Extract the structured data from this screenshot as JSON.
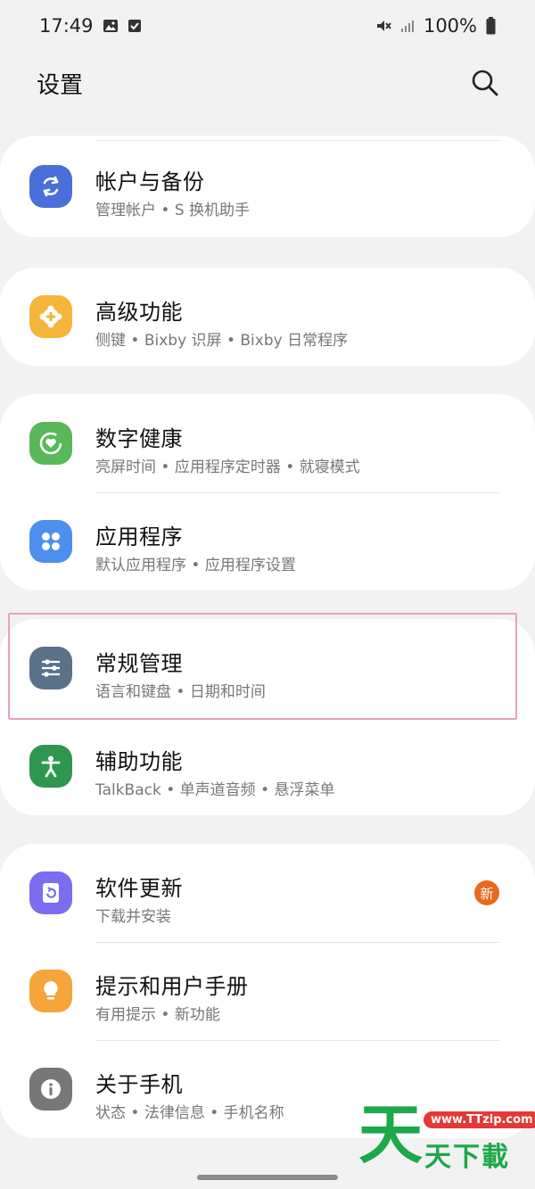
{
  "status_bar": {
    "time": "17:49",
    "icons_left": [
      "image-icon",
      "checkbox-icon"
    ],
    "icons_right": [
      "mute-icon",
      "signal-icon",
      "battery-icon"
    ],
    "battery": "100%"
  },
  "header": {
    "title": "设置",
    "search_icon": "search-icon"
  },
  "sections": [
    {
      "items": [
        {
          "title": "帐户与备份",
          "subtitle": "管理帐户 • S 换机助手",
          "icon": "sync-icon",
          "color": "#4a6fd9"
        }
      ]
    },
    {
      "items": [
        {
          "title": "高级功能",
          "subtitle": "侧键 • Bixby 识屏 • Bixby 日常程序",
          "icon": "gear-plus-icon",
          "color": "#f5b53c"
        }
      ]
    },
    {
      "items": [
        {
          "title": "数字健康",
          "subtitle": "亮屏时间 • 应用程序定时器 • 就寝模式",
          "icon": "heart-circle-icon",
          "color": "#59b85a"
        },
        {
          "title": "应用程序",
          "subtitle": "默认应用程序 • 应用程序设置",
          "icon": "apps-grid-icon",
          "color": "#4d8fef"
        }
      ]
    },
    {
      "items": [
        {
          "title": "常规管理",
          "subtitle": "语言和键盘 • 日期和时间",
          "icon": "sliders-icon",
          "color": "#5b7089"
        },
        {
          "title": "辅助功能",
          "subtitle": "TalkBack • 单声道音频 • 悬浮菜单",
          "icon": "accessibility-icon",
          "color": "#2f9650"
        }
      ]
    },
    {
      "items": [
        {
          "title": "软件更新",
          "subtitle": "下载并安装",
          "icon": "update-icon",
          "color": "#7b6cf0",
          "badge": "新"
        },
        {
          "title": "提示和用户手册",
          "subtitle": "有用提示 • 新功能",
          "icon": "lightbulb-icon",
          "color": "#f5a53a"
        },
        {
          "title": "关于手机",
          "subtitle": "状态 • 法律信息 • 手机名称",
          "icon": "info-icon",
          "color": "#777777"
        }
      ]
    }
  ],
  "watermark": {
    "big": "天",
    "url": "www.TTzip.com",
    "small": "天下載"
  }
}
